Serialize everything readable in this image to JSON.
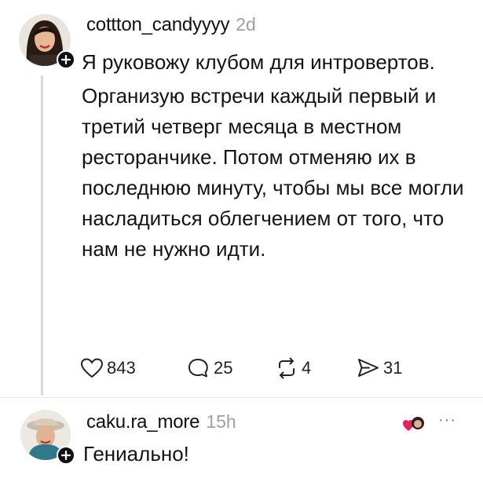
{
  "post": {
    "username": "cottton_candyyyy",
    "time": "2d",
    "paragraphs": [
      "Я руковожу клубом для интровертов.",
      "Организую встречи каждый первый и третий четверг месяца в местном ресторанчике. Потом отменяю их в последнюю минуту, чтобы мы все могли насладиться облегчением от того, что нам не нужно идти."
    ],
    "likes": "843",
    "replies": "25",
    "reposts": "4",
    "shares": "31"
  },
  "reply": {
    "username": "caku.ra_more",
    "time": "15h",
    "text": "Гениально!",
    "more": "···"
  },
  "colors": {
    "text": "#141414",
    "muted": "#a0a0a0",
    "reaction_heart": "#e0245e"
  },
  "icons": [
    "avatar-1",
    "follow-plus-icon",
    "heart-icon",
    "comment-icon",
    "repost-icon",
    "share-icon",
    "heart-face-icon",
    "more-icon"
  ]
}
